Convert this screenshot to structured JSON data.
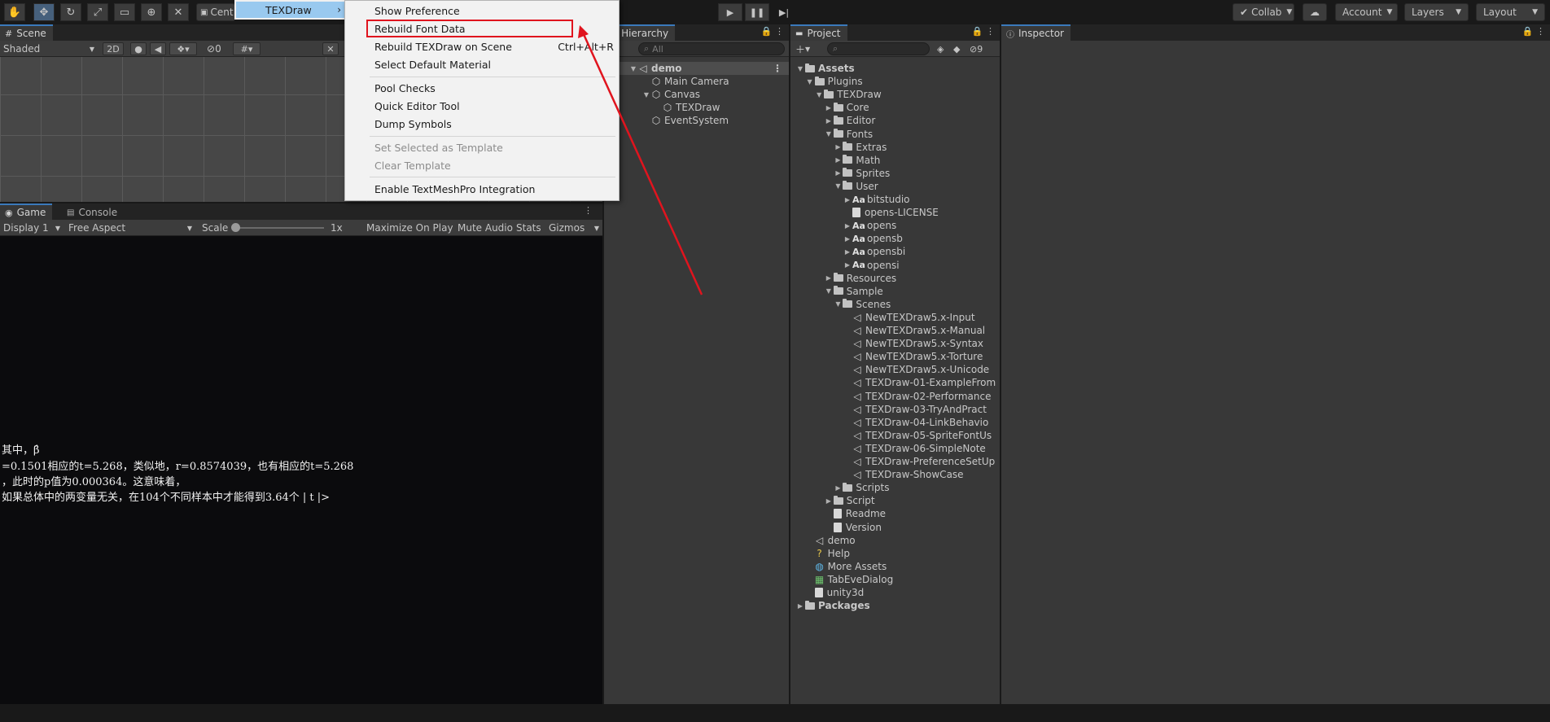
{
  "toolbar": {
    "center_label": "Cent",
    "collab": "Collab",
    "account": "Account",
    "layers": "Layers",
    "layout": "Layout"
  },
  "menu": {
    "parent_item": "TEXDraw",
    "items": [
      {
        "label": "Show Preference",
        "shortcut": "",
        "disabled": false
      },
      {
        "label": "Rebuild Font Data",
        "shortcut": "",
        "disabled": false,
        "highlighted": true
      },
      {
        "label": "Rebuild TEXDraw on Scene",
        "shortcut": "Ctrl+Alt+R",
        "disabled": false
      },
      {
        "label": "Select Default Material",
        "shortcut": "",
        "disabled": false
      },
      {
        "label": "Pool Checks",
        "shortcut": "",
        "disabled": false
      },
      {
        "label": "Quick Editor Tool",
        "shortcut": "",
        "disabled": false
      },
      {
        "label": "Dump Symbols",
        "shortcut": "",
        "disabled": false
      },
      {
        "label": "Set Selected as Template",
        "shortcut": "",
        "disabled": true
      },
      {
        "label": "Clear Template",
        "shortcut": "",
        "disabled": true
      },
      {
        "label": "Enable TextMeshPro Integration",
        "shortcut": "",
        "disabled": false
      }
    ]
  },
  "scene": {
    "tab": "Scene",
    "shading": "Shaded",
    "mode_2d": "2D",
    "hidden_count": "0"
  },
  "game": {
    "tab": "Game",
    "console_tab": "Console",
    "display": "Display 1",
    "aspect": "Free Aspect",
    "scale_label": "Scale",
    "scale_value": "1x",
    "maximize": "Maximize On Play",
    "mute": "Mute Audio",
    "stats": "Stats",
    "gizmos": "Gizmos",
    "lines": [
      "其中，β̂",
      "=0.1501相应的t=5.268，类似地，r=0.8574039，也有相应的t=5.268",
      "，此时的p值为0.000364。这意味着，",
      "如果总体中的两变量无关，在104个不同样本中才能得到3.64个 | t |>"
    ]
  },
  "hierarchy": {
    "tab": "Hierarchy",
    "search_placeholder": "All",
    "scene": "demo",
    "items": [
      {
        "label": "Main Camera",
        "depth": 1
      },
      {
        "label": "Canvas",
        "depth": 1
      },
      {
        "label": "TEXDraw",
        "depth": 2
      },
      {
        "label": "EventSystem",
        "depth": 1
      }
    ]
  },
  "project": {
    "tab": "Project",
    "hidden_count": "9",
    "tree": [
      {
        "label": "Assets",
        "depth": 0,
        "kind": "folder",
        "open": true,
        "bold": true
      },
      {
        "label": "Plugins",
        "depth": 1,
        "kind": "folder",
        "open": true
      },
      {
        "label": "TEXDraw",
        "depth": 2,
        "kind": "folder",
        "open": true
      },
      {
        "label": "Core",
        "depth": 3,
        "kind": "folder",
        "open": false
      },
      {
        "label": "Editor",
        "depth": 3,
        "kind": "folder",
        "open": false
      },
      {
        "label": "Fonts",
        "depth": 3,
        "kind": "folder",
        "open": true
      },
      {
        "label": "Extras",
        "depth": 4,
        "kind": "folder",
        "open": false
      },
      {
        "label": "Math",
        "depth": 4,
        "kind": "folder",
        "open": false
      },
      {
        "label": "Sprites",
        "depth": 4,
        "kind": "folder",
        "open": false
      },
      {
        "label": "User",
        "depth": 4,
        "kind": "folder",
        "open": true
      },
      {
        "label": "bitstudio",
        "depth": 5,
        "kind": "font",
        "open": false
      },
      {
        "label": "opens-LICENSE",
        "depth": 5,
        "kind": "file"
      },
      {
        "label": "opens",
        "depth": 5,
        "kind": "font",
        "open": false
      },
      {
        "label": "opensb",
        "depth": 5,
        "kind": "font",
        "open": false
      },
      {
        "label": "opensbi",
        "depth": 5,
        "kind": "font",
        "open": false
      },
      {
        "label": "opensi",
        "depth": 5,
        "kind": "font",
        "open": false
      },
      {
        "label": "Resources",
        "depth": 3,
        "kind": "folder",
        "open": false
      },
      {
        "label": "Sample",
        "depth": 3,
        "kind": "folder",
        "open": true
      },
      {
        "label": "Scenes",
        "depth": 4,
        "kind": "folder",
        "open": true
      },
      {
        "label": "NewTEXDraw5.x-Input",
        "depth": 5,
        "kind": "scene"
      },
      {
        "label": "NewTEXDraw5.x-Manual",
        "depth": 5,
        "kind": "scene"
      },
      {
        "label": "NewTEXDraw5.x-Syntax",
        "depth": 5,
        "kind": "scene"
      },
      {
        "label": "NewTEXDraw5.x-Torture",
        "depth": 5,
        "kind": "scene"
      },
      {
        "label": "NewTEXDraw5.x-Unicode",
        "depth": 5,
        "kind": "scene"
      },
      {
        "label": "TEXDraw-01-ExampleFrom",
        "depth": 5,
        "kind": "scene"
      },
      {
        "label": "TEXDraw-02-Performance",
        "depth": 5,
        "kind": "scene"
      },
      {
        "label": "TEXDraw-03-TryAndPract",
        "depth": 5,
        "kind": "scene"
      },
      {
        "label": "TEXDraw-04-LinkBehavio",
        "depth": 5,
        "kind": "scene"
      },
      {
        "label": "TEXDraw-05-SpriteFontUs",
        "depth": 5,
        "kind": "scene"
      },
      {
        "label": "TEXDraw-06-SimpleNote",
        "depth": 5,
        "kind": "scene"
      },
      {
        "label": "TEXDraw-PreferenceSetUp",
        "depth": 5,
        "kind": "scene"
      },
      {
        "label": "TEXDraw-ShowCase",
        "depth": 5,
        "kind": "scene"
      },
      {
        "label": "Scripts",
        "depth": 4,
        "kind": "folder",
        "open": false
      },
      {
        "label": "Script",
        "depth": 3,
        "kind": "folder",
        "open": false
      },
      {
        "label": "Readme",
        "depth": 3,
        "kind": "file"
      },
      {
        "label": "Version",
        "depth": 3,
        "kind": "file"
      },
      {
        "label": "demo",
        "depth": 1,
        "kind": "scene"
      },
      {
        "label": "Help",
        "depth": 1,
        "kind": "help"
      },
      {
        "label": "More Assets",
        "depth": 1,
        "kind": "globe"
      },
      {
        "label": "TabEveDialog",
        "depth": 1,
        "kind": "script"
      },
      {
        "label": "unity3d",
        "depth": 1,
        "kind": "file"
      },
      {
        "label": "Packages",
        "depth": 0,
        "kind": "folder",
        "open": false,
        "bold": true
      }
    ]
  },
  "inspector": {
    "tab": "Inspector"
  },
  "colors": {
    "highlight_box": "#e0141e",
    "arrow": "#e0141e",
    "tab_accent": "#3a79bb"
  }
}
